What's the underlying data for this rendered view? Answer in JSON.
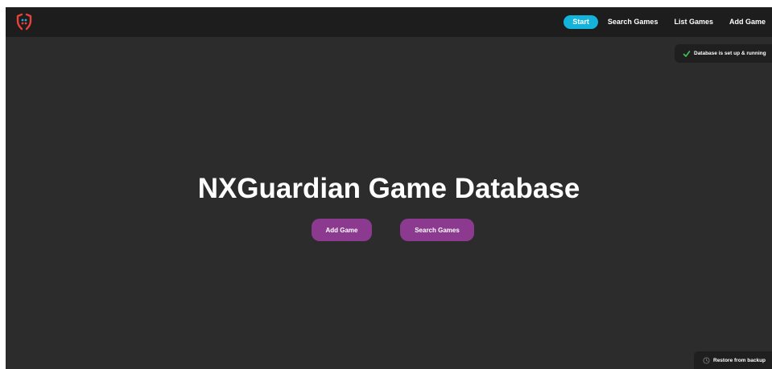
{
  "nav": {
    "logo_icon": "shield-face-icon",
    "links": [
      {
        "label": "Start",
        "active": true
      },
      {
        "label": "Search Games",
        "active": false
      },
      {
        "label": "List Games",
        "active": false
      },
      {
        "label": "Add Game",
        "active": false
      }
    ]
  },
  "status": {
    "icon": "check-icon",
    "message": "Database is set up & running"
  },
  "hero": {
    "title": "NXGuardian Game Database",
    "add_button": "Add Game",
    "search_button": "Search Games"
  },
  "restore": {
    "icon": "clock-icon",
    "label": "Restore from backup"
  },
  "colors": {
    "background": "#2c2c2c",
    "navbar": "#1d1d1d",
    "accent_active": "#14b3dc",
    "button": "#8b3a8f",
    "logo_red": "#e8403a",
    "logo_blue": "#2aa7d6",
    "check_green": "#3cc65a"
  }
}
